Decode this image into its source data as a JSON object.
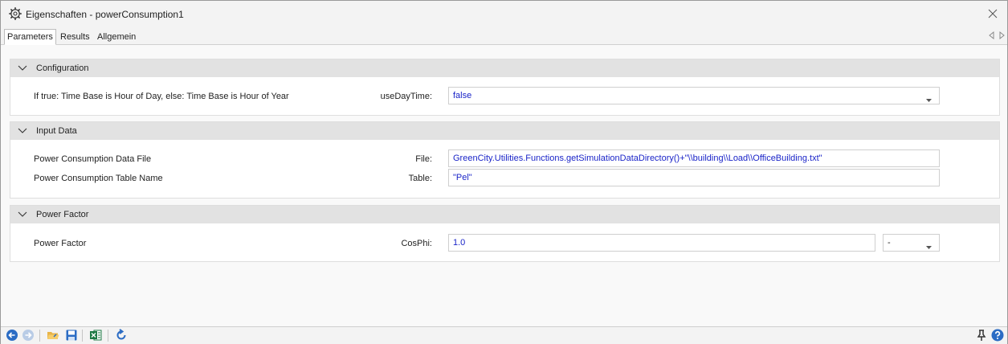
{
  "window": {
    "title": "Eigenschaften - powerConsumption1",
    "title_icon": "gear-icon",
    "close_icon": "close-icon"
  },
  "tabs": [
    {
      "label": "Parameters",
      "active": true
    },
    {
      "label": "Results",
      "active": false
    },
    {
      "label": "Allgemein",
      "active": false
    }
  ],
  "sections": {
    "configuration": {
      "title": "Configuration",
      "rows": [
        {
          "description": "If true: Time Base is Hour of Day, else: Time Base is Hour of Year",
          "key": "useDayTime:",
          "value": "false",
          "type": "dropdown"
        }
      ]
    },
    "input_data": {
      "title": "Input Data",
      "rows": [
        {
          "description": "Power Consumption Data File",
          "key": "File:",
          "value": "GreenCity.Utilities.Functions.getSimulationDataDirectory()+\"\\\\building\\\\Load\\\\OfficeBuilding.txt\"",
          "type": "text"
        },
        {
          "description": "Power Consumption Table Name",
          "key": "Table:",
          "value": "\"Pel\"",
          "type": "text"
        }
      ]
    },
    "power_factor": {
      "title": "Power Factor",
      "rows": [
        {
          "description": "Power Factor",
          "key": "CosPhi:",
          "value": "1.0",
          "unit": "-",
          "type": "text+unit"
        }
      ]
    }
  },
  "toolbar_icons": [
    "back-icon",
    "forward-icon",
    "open-folder-icon",
    "save-icon",
    "excel-icon",
    "refresh-icon",
    "pin-icon",
    "help-icon"
  ],
  "colors": {
    "value_text": "#1a24c8",
    "section_header": "#e2e2e2",
    "icon_blue": "#2b6cc4",
    "excel_green": "#1e7a45"
  }
}
